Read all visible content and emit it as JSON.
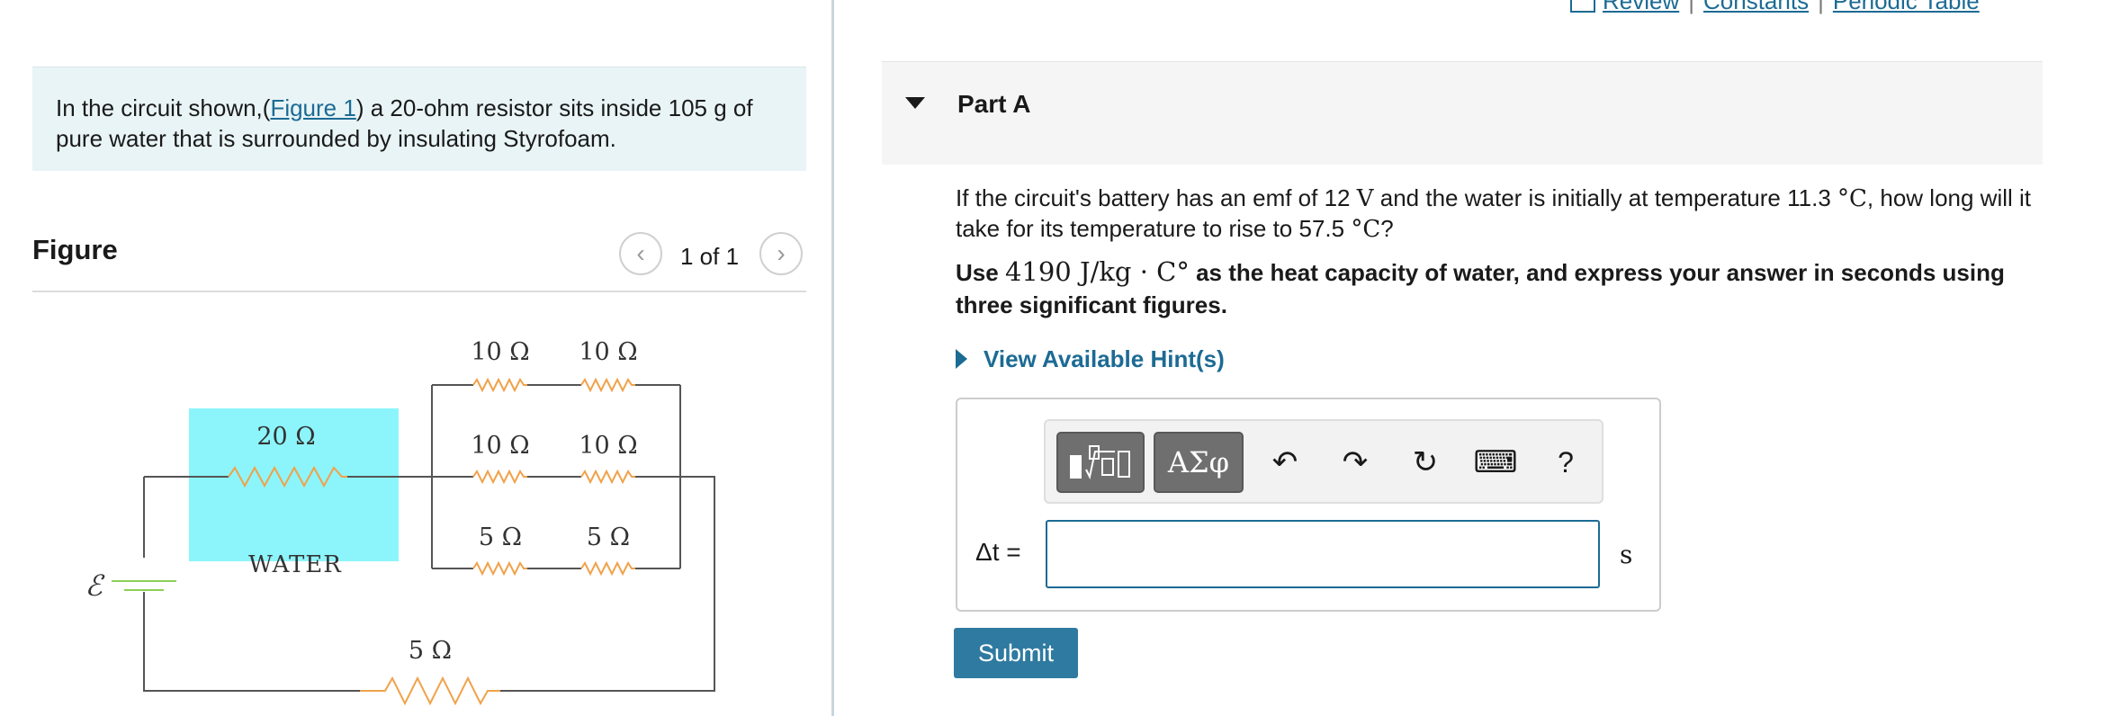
{
  "top_links": {
    "review": "Review",
    "constants": "Constants",
    "periodic_table": "Periodic Table",
    "separator": "|"
  },
  "intro": {
    "text_before": "In the circuit shown,(",
    "figure_link": "Figure 1",
    "text_after": ") a 20-ohm resistor sits inside 105 g of pure water that is surrounded by insulating Styrofoam."
  },
  "figure_panel": {
    "title": "Figure",
    "counter": "1 of 1",
    "prev_glyph": "‹",
    "next_glyph": "›"
  },
  "circuit": {
    "water_label": "WATER",
    "emf_symbol": "ℰ",
    "r_water": "20 Ω",
    "r_top_left": "10 Ω",
    "r_top_right": "10 Ω",
    "r_mid_left": "10 Ω",
    "r_mid_right": "10 Ω",
    "r_bot_left": "5 Ω",
    "r_bot_right": "5 Ω",
    "r_series": "5 Ω",
    "colors": {
      "water_fill": "#8cf5fb",
      "resistor": "#f0a24a",
      "wire": "#555555"
    }
  },
  "part": {
    "title": "Part A",
    "question_p1": "If the circuit's battery has an emf of 12",
    "question_v": "V",
    "question_p2": " and the water is initially at temperature 11.3",
    "question_c1": "°C",
    "question_p3": ", how long will it take for its temperature to rise to 57.5",
    "question_c2": "°C",
    "question_p4": "?",
    "instr_p1": "Use",
    "instr_math": "4190 J/kg · C°",
    "instr_p2": "as the heat capacity of water, and express your answer in seconds using three significant figures.",
    "hint_label": "View Available Hint(s)"
  },
  "toolbar": {
    "greek_label": "ΑΣφ",
    "undo_glyph": "↶",
    "redo_glyph": "↷",
    "reset_glyph": "↻",
    "keyboard_glyph": "⌨",
    "help_label": "?"
  },
  "answer": {
    "variable_label": "Δt =",
    "value": "",
    "unit": "s"
  },
  "submit_label": "Submit",
  "colors": {
    "accent": "#1c6b94",
    "button": "#2f7aa0",
    "intro_bg": "#e9f4f6"
  }
}
